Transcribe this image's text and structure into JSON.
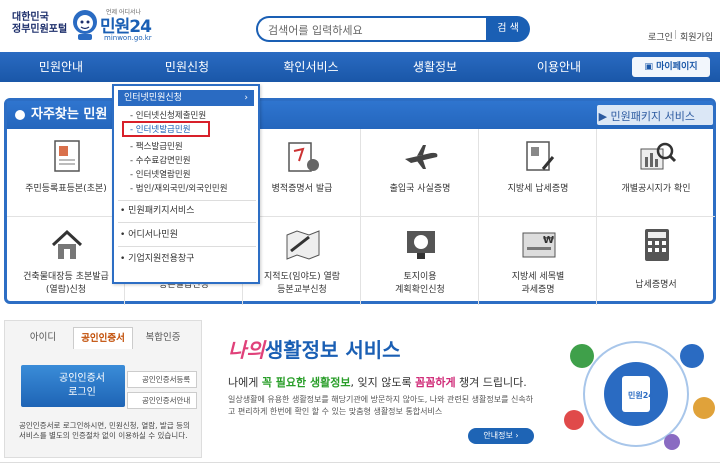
{
  "header": {
    "portal_line1": "대한민국",
    "portal_line2": "정부민원포털",
    "logo_small": "언제 어디서나",
    "logo_text": "민원24",
    "logo_url": "minwon.go.kr",
    "search_placeholder": "검색어를 입력하세요",
    "search_button": "검 색",
    "login": "로그인",
    "divider": "|",
    "signup": "회원가입"
  },
  "nav": {
    "items": [
      "민원안내",
      "민원신청",
      "확인서비스",
      "생활정보",
      "이용안내"
    ],
    "mypage": "마이페이지"
  },
  "freq": {
    "title": "자주찾는 민원",
    "pkg_link": "민원패키지 서비스",
    "row1": [
      {
        "label": "주민등록표등본(초본)",
        "icon": "resident-doc-icon"
      },
      {
        "label": "",
        "icon": ""
      },
      {
        "label": "병적증명서 발급",
        "icon": "military-cert-icon"
      },
      {
        "label": "출입국 사실증명",
        "icon": "airplane-icon"
      },
      {
        "label": "지방세 납세증명",
        "icon": "tax-doc-icon"
      },
      {
        "label": "개별공시지가 확인",
        "icon": "land-price-icon"
      }
    ],
    "row2": [
      {
        "label1": "건축물대장등 초본발급",
        "label2": "(열람)신청",
        "icon": "house-icon"
      },
      {
        "label1": "등본발급신청",
        "label2": "",
        "icon": ""
      },
      {
        "label1": "지적도(임야도) 열람",
        "label2": "등본교부신청",
        "icon": "map-icon"
      },
      {
        "label1": "토지이용",
        "label2": "계획확인신청",
        "icon": "land-plan-icon"
      },
      {
        "label1": "지방세 세목별",
        "label2": "과세증명",
        "icon": "tax-card-icon"
      },
      {
        "label1": "납세증명서",
        "label2": "",
        "icon": "calculator-icon"
      }
    ]
  },
  "dropdown": {
    "head": "인터넷민원신청",
    "arrow": "›",
    "subs": [
      "인터넷신청제출민원",
      "인터넷발급민원",
      "팩스발급민원",
      "수수료감면민원",
      "인터넷열람민원",
      "법인/재외국민/외국인민원"
    ],
    "mains": [
      "민원패키지서비스",
      "어디서나민원",
      "기업지원전용창구"
    ]
  },
  "login": {
    "tabs": [
      "아이디",
      "공인인증서",
      "복합인증"
    ],
    "cert_btn_line1": "공인인증서",
    "cert_btn_line2": "로그인",
    "small1": "공인인증서등록",
    "small2": "공인인증서안내",
    "note": "공인인증서로 로그인하시면, 민원신청, 열람, 발급 등의 서비스를 별도의 인증절차 없이 이용하실 수 있습니다."
  },
  "life": {
    "title_nai": "나의",
    "title_rest": "생활정보 서비스",
    "sub_pre": "나에게 ",
    "sub_g": "꼭 필요한 생활정보",
    "sub_mid": ", 잊지 않도록 ",
    "sub_p": "꼼꼼하게",
    "sub_post": " 챙겨 드립니다.",
    "desc": "일상생활에 유용한 생활정보를 해당기관에 방문하지 않아도, 나와 관련된 생활정보를 신속하고 편리하게 한번에 확인 할 수 있는 맞춤형 생활정보 통합서비스",
    "guide_btn": "안내정보 ›",
    "circle_label": "민원24"
  }
}
